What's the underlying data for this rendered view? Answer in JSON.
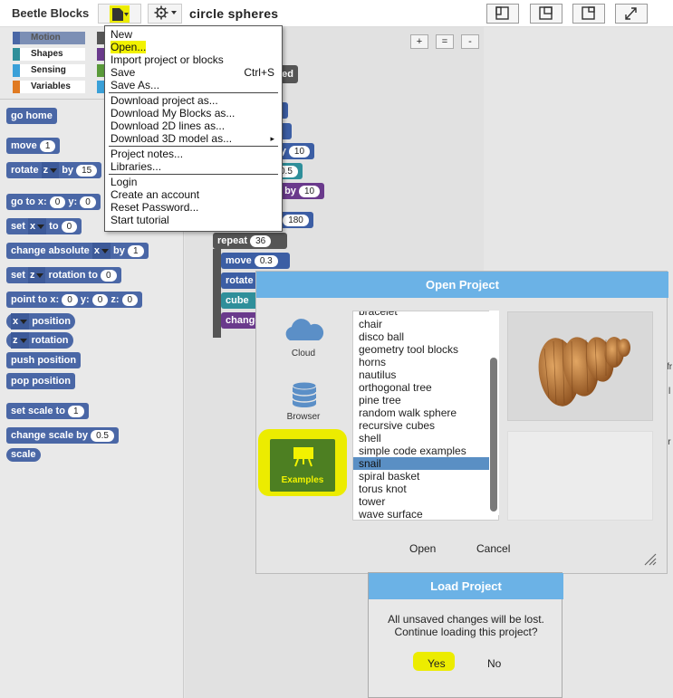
{
  "app": {
    "title": "Beetle Blocks",
    "project_name": "circle  spheres"
  },
  "toolbar": {
    "file_icon": "file-icon",
    "settings_icon": "gear-icon",
    "view_buttons": [
      "normal-view-icon",
      "stage-view-icon",
      "small-stage-icon",
      "fullscreen-icon"
    ]
  },
  "categories": [
    {
      "label": "Motion",
      "color": "#4a67a6"
    },
    {
      "label": "Shapes",
      "color": "#2f8f9a"
    },
    {
      "label": "Sensing",
      "color": "#3aa0d8"
    },
    {
      "label": "Variables",
      "color": "#e07a22"
    }
  ],
  "palette": {
    "go_home": "go home",
    "move": "move",
    "move_val": "1",
    "rotate": "rotate",
    "rotate_axis": "z",
    "rotate_by": "by",
    "rotate_val": "15",
    "goto": "go to x:",
    "goto_x": "0",
    "goto_y_label": "y:",
    "goto_y": "0",
    "set": "set",
    "set_axis": "x",
    "set_to": "to",
    "set_val": "0",
    "change_abs": "change absolute",
    "change_abs_axis": "x",
    "change_abs_by": "by",
    "change_abs_val": "1",
    "set_rot": "set",
    "set_rot_axis": "z",
    "set_rot_label": "rotation to",
    "set_rot_val": "0",
    "point_to": "point to x:",
    "point_x": "0",
    "point_y_label": "y:",
    "point_y": "0",
    "point_z_label": "z:",
    "point_z": "0",
    "x_position_axis": "x",
    "x_position": "position",
    "z_rotation_axis": "z",
    "z_rotation": "rotation",
    "push_position": "push position",
    "pop_position": "pop position",
    "set_scale": "set scale to",
    "set_scale_val": "1",
    "change_scale": "change scale by",
    "change_scale_val": "0.5",
    "scale": "scale"
  },
  "zoom": {
    "plus": "+",
    "equal": "=",
    "minus": "-"
  },
  "script": {
    "when_clicked": "ked",
    "by_label": "by",
    "by_val": "10",
    "teal_val": "0.5",
    "purple_by": "by",
    "purple_val": "10",
    "y_label": "y",
    "y_val": "180",
    "repeat": "repeat",
    "repeat_val": "36",
    "move": "move",
    "move_val": "0.3",
    "rotate": "rotate",
    "cube": "cube",
    "change": "change"
  },
  "file_menu": {
    "items": [
      {
        "label": "New"
      },
      {
        "label": "Open...",
        "highlight": true
      },
      {
        "label": "Import project or blocks"
      },
      {
        "label": "Save",
        "shortcut": "Ctrl+S"
      },
      {
        "label": "Save As..."
      },
      {
        "sep": true
      },
      {
        "label": "Download project as..."
      },
      {
        "label": "Download My Blocks as..."
      },
      {
        "label": "Download 2D lines as..."
      },
      {
        "label": "Download 3D model as...",
        "submenu": "▸"
      },
      {
        "sep": true
      },
      {
        "label": "Project notes..."
      },
      {
        "label": "Libraries..."
      },
      {
        "sep": true
      },
      {
        "label": "Login"
      },
      {
        "label": "Create an account"
      },
      {
        "label": "Reset Password..."
      },
      {
        "label": "Start tutorial"
      }
    ]
  },
  "open_dialog": {
    "title": "Open Project",
    "sources": [
      {
        "label": "Cloud",
        "icon": "cloud-icon"
      },
      {
        "label": "Browser",
        "icon": "database-icon"
      },
      {
        "label": "Examples",
        "icon": "easel-icon",
        "selected": true
      }
    ],
    "projects": [
      "bracelet",
      "chair",
      "disco ball",
      "geometry tool blocks",
      "horns",
      "nautilus",
      "orthogonal tree",
      "pine tree",
      "random walk sphere",
      "recursive cubes",
      "shell",
      "simple code examples",
      "snail",
      "spiral basket",
      "torus knot",
      "tower",
      "wave surface"
    ],
    "selected": "snail",
    "open_label": "Open",
    "cancel_label": "Cancel"
  },
  "load_dialog": {
    "title": "Load Project",
    "line1": "All unsaved changes will be lost.",
    "line2": "Continue loading this project?",
    "yes": "Yes",
    "no": "No"
  },
  "stage_peek": {
    "a": "fr",
    "b": "l",
    "c": "lr"
  }
}
